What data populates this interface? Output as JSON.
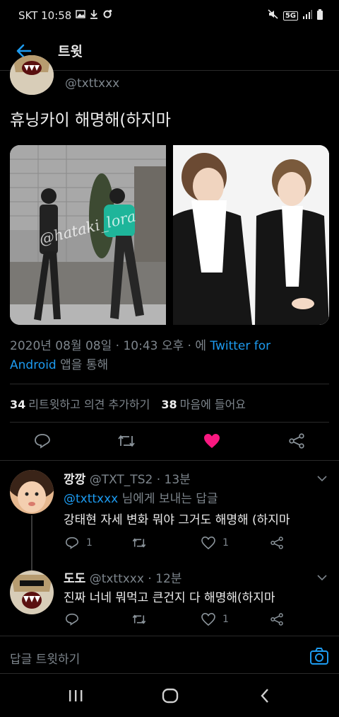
{
  "status_bar": {
    "carrier_time": "SKT 10:58",
    "icons": [
      "gallery-icon",
      "download-icon",
      "settings-icon",
      "mute-icon",
      "5g-icon",
      "signal-icon",
      "battery-icon"
    ],
    "network": "5G"
  },
  "header": {
    "title": "트윗"
  },
  "author": {
    "handle": "@txttxxx"
  },
  "tweet": {
    "text": "휴닝카이 해명해(하지마",
    "watermark": "@hataki_lora",
    "timestamp": "2020년 08월 08일 · 10:43 오후 · 에",
    "source_prefix": "Twitter for",
    "source_suffix": "Android",
    "source_tail": "앱을 통해"
  },
  "stats": {
    "retweets_count": "34",
    "retweets_label": "리트윗하고 의견 추가하기",
    "likes_count": "38",
    "likes_label": "마음에 들어요"
  },
  "colors": {
    "accent": "#1d9bf0",
    "like": "#f91880",
    "background": "#000000",
    "muted": "#7d858c"
  },
  "replies": [
    {
      "name": "깡깡",
      "handle": "@TXT_TS2",
      "time": "· 13분",
      "replying_to_handle": "@txttxxx",
      "replying_to_text": "님에게 보내는 답글",
      "text": "강태현 자세 변화 뭐야 그거도 해명해 (하지마",
      "reply_count": "1",
      "like_count": "1"
    },
    {
      "name": "도도",
      "handle": "@txttxxx",
      "time": "· 12분",
      "text": "진짜 너네 뭐먹고 큰건지 다 해명해(하지마",
      "reply_count": "",
      "like_count": "1"
    }
  ],
  "compose": {
    "placeholder": "답글 트윗하기"
  }
}
